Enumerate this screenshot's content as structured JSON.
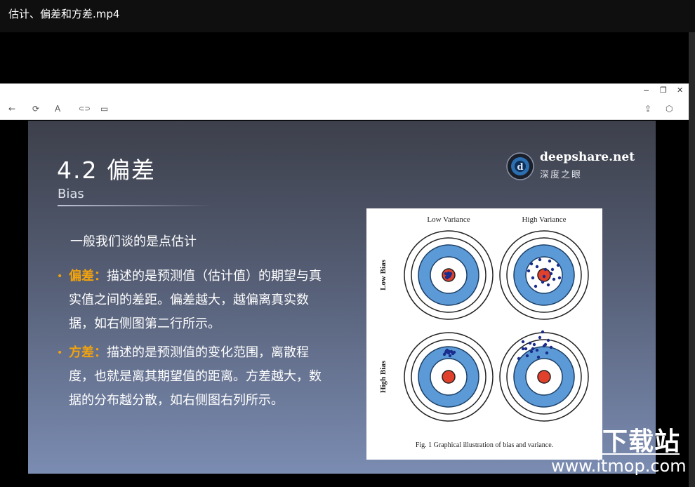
{
  "player": {
    "title": "估计、偏差和方差.mp4"
  },
  "viewer": {
    "window_buttons": [
      "−",
      "❐",
      "✕"
    ],
    "toolbar": {
      "back_icon": "←",
      "refresh_icon": "⟳",
      "read_aloud_icon": "A",
      "link_icon": "⊂⊃",
      "tab_icon": "▭",
      "share_icon": "⇪",
      "extension_icon": "⬡"
    }
  },
  "slide": {
    "title": "4.2 偏差",
    "subtitle": "Bias",
    "logo": {
      "name": "deepshare.net",
      "cn": "深度之眼"
    },
    "intro": "一般我们谈的是点估计",
    "bullets": [
      {
        "key": "偏差：",
        "text": "描述的是预测值（估计值）的期望与真实值之间的差距。偏差越大，越偏离真实数据，如右侧图第二行所示。"
      },
      {
        "key": "方差：",
        "text": "描述的是预测值的变化范围，离散程度，也就是离其期望值的距离。方差越大，数据的分布越分散，如右侧图右列所示。"
      }
    ],
    "figure": {
      "col_labels": [
        "Low Variance",
        "High Variance"
      ],
      "row_labels": [
        "Low Bias",
        "High Bias"
      ],
      "caption": "Fig. 1 Graphical illustration of bias and variance."
    }
  },
  "watermark": {
    "cn": "下载站",
    "url": "www.itmop.com"
  }
}
